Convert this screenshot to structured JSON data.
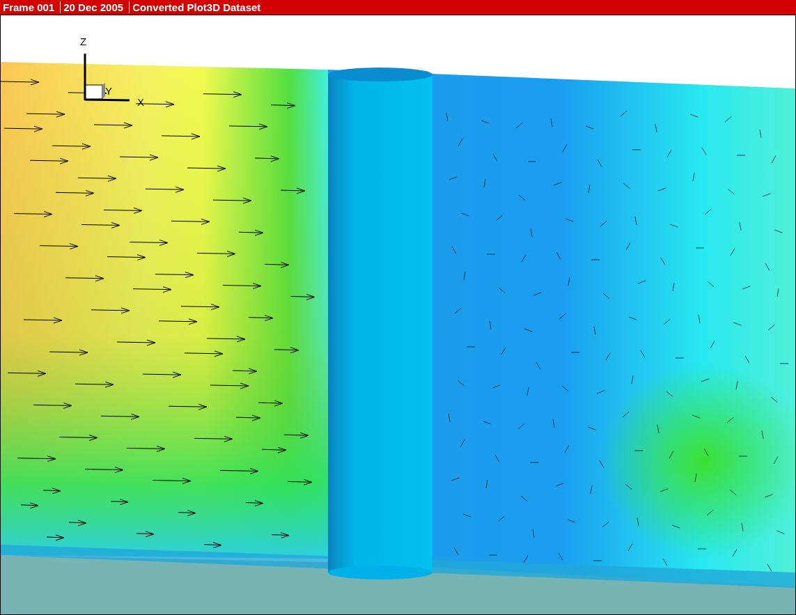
{
  "header": {
    "fields": [
      "Frame 001",
      "20 Dec 2005",
      "Converted Plot3D Dataset"
    ]
  },
  "axes": {
    "labels": [
      "Z",
      "Y",
      "X"
    ]
  }
}
